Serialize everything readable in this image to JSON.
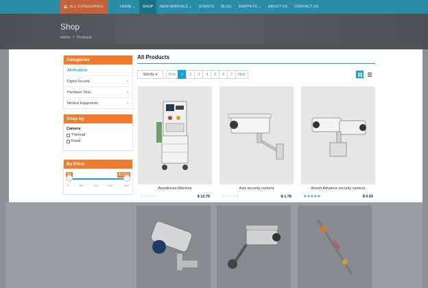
{
  "topnav": {
    "categories_label": "ALL CATEGORIES",
    "items": [
      {
        "label": "HOME ⌄",
        "active": false
      },
      {
        "label": "SHOP",
        "active": true
      },
      {
        "label": "NEW ARRIVALS ⌄",
        "active": false
      },
      {
        "label": "EVENTS",
        "active": false
      },
      {
        "label": "BLOG",
        "active": false
      },
      {
        "label": "SNIPPETS ⌄",
        "active": false
      },
      {
        "label": "ABOUT US",
        "active": false
      },
      {
        "label": "CONTACT US",
        "active": false
      }
    ]
  },
  "hero": {
    "title": "Shop",
    "breadcrumb": [
      "Home",
      "/",
      "Products"
    ]
  },
  "sidebar": {
    "categories_title": "Categories",
    "categories": [
      {
        "label": "All Products",
        "active": true,
        "expandable": false
      },
      {
        "label": "Digital Security",
        "active": false,
        "expandable": true
      },
      {
        "label": "Hardware Tools",
        "active": false,
        "expandable": true
      },
      {
        "label": "Medical Equipments",
        "active": false,
        "expandable": true
      }
    ],
    "shopby_title": "Shop by",
    "shopby_group": "Camera",
    "shopby_options": [
      "Thermal",
      "Fixed"
    ],
    "price_title": "By Price",
    "price_min": "$0",
    "price_max": "$1,529",
    "price_scale": [
      "0",
      "382",
      "765",
      "1147",
      "1529"
    ]
  },
  "main": {
    "title": "All Products",
    "sort_label": "Sort By ▾",
    "pager": [
      "Prev",
      "1",
      "2",
      "3",
      "4",
      "5",
      "6",
      "7",
      "Next"
    ],
    "pager_active": "1",
    "products": [
      {
        "name": "Anesthesia Machine",
        "price": "$ 12.75",
        "rating": 0,
        "icon": "anesthesia-machine"
      },
      {
        "name": "Axis security camera",
        "price": "$ 1.78",
        "rating": 0,
        "icon": "security-camera"
      },
      {
        "name": "Bosch Advance security camera",
        "price": "$ 0.03",
        "rating": 5,
        "icon": "dual-security-camera"
      }
    ],
    "more_products_icons": [
      "bullet-camera",
      "wall-camera",
      "tool"
    ]
  },
  "colors": {
    "accent": "#1aa0d6",
    "orange": "#f07a2e",
    "topbar": "#2b8ca6"
  }
}
